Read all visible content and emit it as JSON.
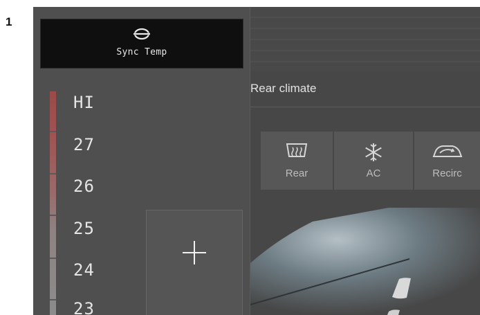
{
  "step": {
    "number": "1"
  },
  "sync": {
    "label": "Sync Temp",
    "icon": "sync-temp-icon"
  },
  "temperature": {
    "levels": [
      "HI",
      "27",
      "26",
      "25",
      "24",
      "23"
    ],
    "bar_colors": {
      "hot": "#9c4a4a",
      "neutral": "#8c8c8c"
    }
  },
  "plus_button": {
    "symbol": "+"
  },
  "panel": {
    "title": "Rear climate",
    "buttons": [
      {
        "label": "Rear",
        "icon": "rear-defrost-icon"
      },
      {
        "label": "AC",
        "icon": "ac-snowflake-icon"
      },
      {
        "label": "Recirc",
        "icon": "recirculation-icon"
      }
    ]
  },
  "colors": {
    "screen_bg": "#4b4b4b",
    "sync_bg": "#0f0f0f",
    "text": "#e6e6e6",
    "button_bg": "#575757"
  }
}
